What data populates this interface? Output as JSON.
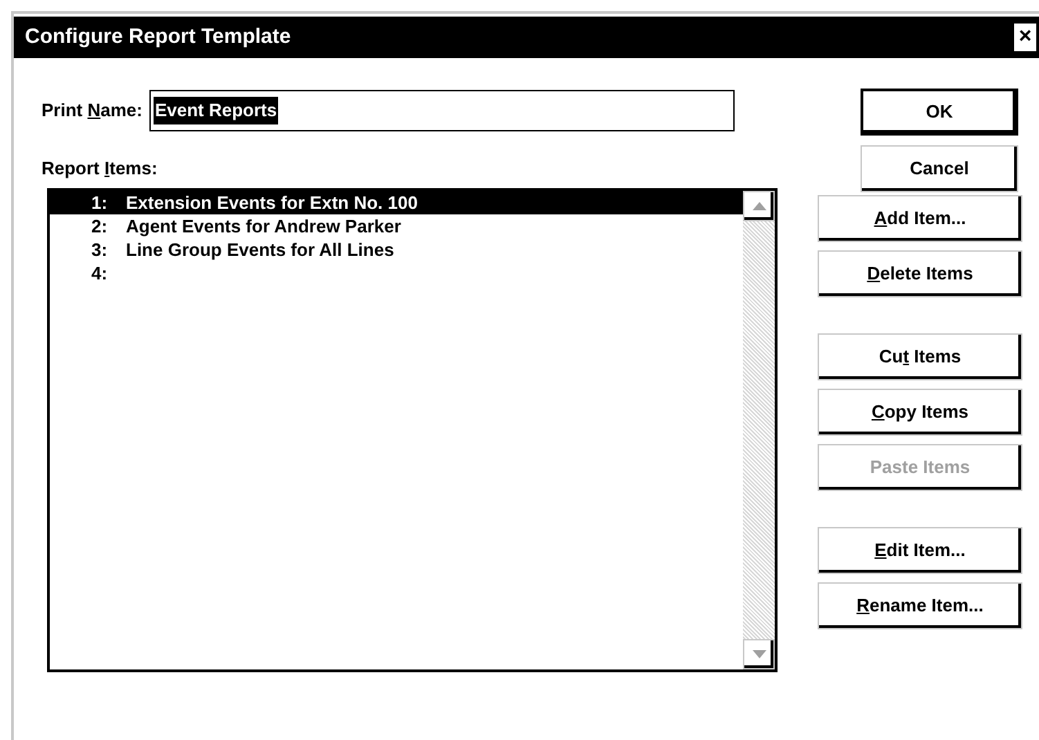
{
  "window": {
    "title": "Configure Report Template",
    "close": "×"
  },
  "print_name": {
    "label": [
      {
        "t": "Print "
      },
      {
        "t": "N",
        "u": true
      },
      {
        "t": "ame:"
      }
    ],
    "value": "Event Reports",
    "selected_text": true
  },
  "report_items": {
    "label": [
      {
        "t": "Report "
      },
      {
        "t": "I",
        "u": true
      },
      {
        "t": "tems:"
      }
    ],
    "items": [
      {
        "number": "1:",
        "text": "Extension Events for Extn No. 100",
        "selected": true
      },
      {
        "number": "2:",
        "text": "Agent Events for Andrew Parker",
        "selected": false
      },
      {
        "number": "3:",
        "text": "Line Group Events for All Lines",
        "selected": false
      },
      {
        "number": "4:",
        "selected": false
      }
    ]
  },
  "dialog_buttons": [
    {
      "label": [
        {
          "t": "OK"
        }
      ],
      "default": true
    },
    {
      "label": [
        {
          "t": "Cancel"
        }
      ],
      "default": false
    }
  ],
  "item_button_groups": [
    [
      {
        "label": [
          {
            "t": "A",
            "u": true
          },
          {
            "t": "dd Item..."
          }
        ],
        "disabled": false
      },
      {
        "label": [
          {
            "t": "D",
            "u": true
          },
          {
            "t": "elete Items"
          }
        ],
        "disabled": false
      }
    ],
    [
      {
        "label": [
          {
            "t": "Cu"
          },
          {
            "t": "t",
            "u": true
          },
          {
            "t": " Items"
          }
        ],
        "disabled": false
      },
      {
        "label": [
          {
            "t": "C",
            "u": true
          },
          {
            "t": "opy Items"
          }
        ],
        "disabled": false
      },
      {
        "label": [
          {
            "t": "Paste Items"
          }
        ],
        "disabled": true
      }
    ],
    [
      {
        "label": [
          {
            "t": "E",
            "u": true
          },
          {
            "t": "dit Item..."
          }
        ],
        "disabled": false
      },
      {
        "label": [
          {
            "t": "R",
            "u": true
          },
          {
            "t": "ename Item..."
          }
        ],
        "disabled": false
      }
    ]
  ]
}
